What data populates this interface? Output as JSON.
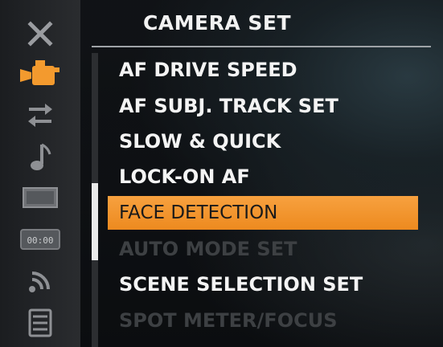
{
  "menu_title": "CAMERA SET",
  "colors": {
    "accent_orange": "#F39A2E",
    "sidebar_bg": "#232528",
    "text_primary": "#F4F4F4",
    "text_disabled": "#3D4043"
  },
  "sidebar": {
    "icons": [
      {
        "name": "close-icon",
        "state": "normal"
      },
      {
        "name": "video-camera-icon",
        "state": "active"
      },
      {
        "name": "transfer-arrows-icon",
        "state": "normal"
      },
      {
        "name": "music-note-icon",
        "state": "normal"
      },
      {
        "name": "display-icon",
        "state": "normal"
      },
      {
        "name": "timecode-icon",
        "state": "normal",
        "label": "00:00"
      },
      {
        "name": "wifi-icon",
        "state": "normal"
      },
      {
        "name": "setup-list-icon",
        "state": "normal"
      }
    ]
  },
  "menu": {
    "items": [
      {
        "label": "AF DRIVE SPEED",
        "state": "normal"
      },
      {
        "label": "AF SUBJ. TRACK SET",
        "state": "normal"
      },
      {
        "label": "SLOW & QUICK",
        "state": "normal"
      },
      {
        "label": "LOCK-ON AF",
        "state": "normal"
      },
      {
        "label": "FACE DETECTION",
        "state": "selected"
      },
      {
        "label": "AUTO MODE SET",
        "state": "disabled"
      },
      {
        "label": "SCENE SELECTION SET",
        "state": "normal"
      },
      {
        "label": "SPOT METER/FOCUS",
        "state": "disabled"
      }
    ]
  },
  "scrollbar": {
    "position_fraction": 0.45,
    "visible_fraction": 0.26
  }
}
